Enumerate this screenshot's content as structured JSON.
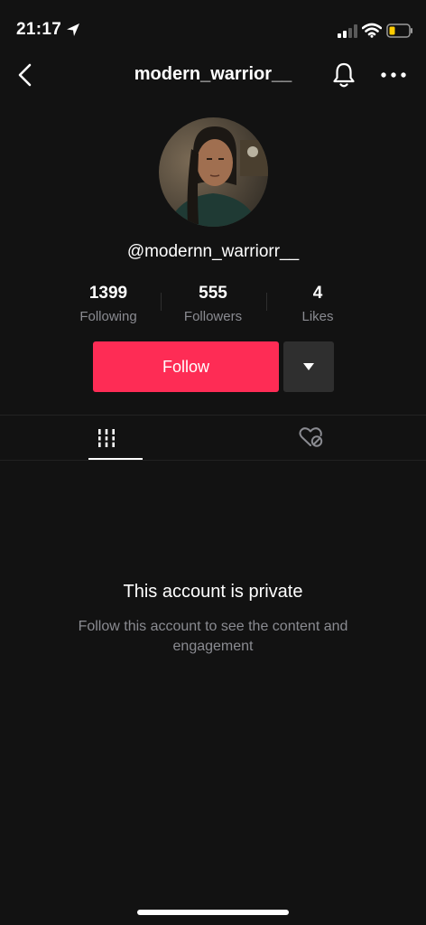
{
  "status_bar": {
    "time": "21:17"
  },
  "nav": {
    "title": "modern_warrior__"
  },
  "profile": {
    "username": "@modernn_warriorr__"
  },
  "stats": [
    {
      "value": "1399",
      "label": "Following"
    },
    {
      "value": "555",
      "label": "Followers"
    },
    {
      "value": "4",
      "label": "Likes"
    }
  ],
  "actions": {
    "follow_label": "Follow"
  },
  "tabs": [
    {
      "icon": "grid-icon",
      "active": true
    },
    {
      "icon": "liked-hidden-icon",
      "active": false
    }
  ],
  "private_notice": {
    "title": "This account is private",
    "description": "Follow this account to see the content and engagement"
  },
  "colors": {
    "accent": "#fe2c55",
    "background": "#121212",
    "secondary_text": "#8a8b91"
  }
}
